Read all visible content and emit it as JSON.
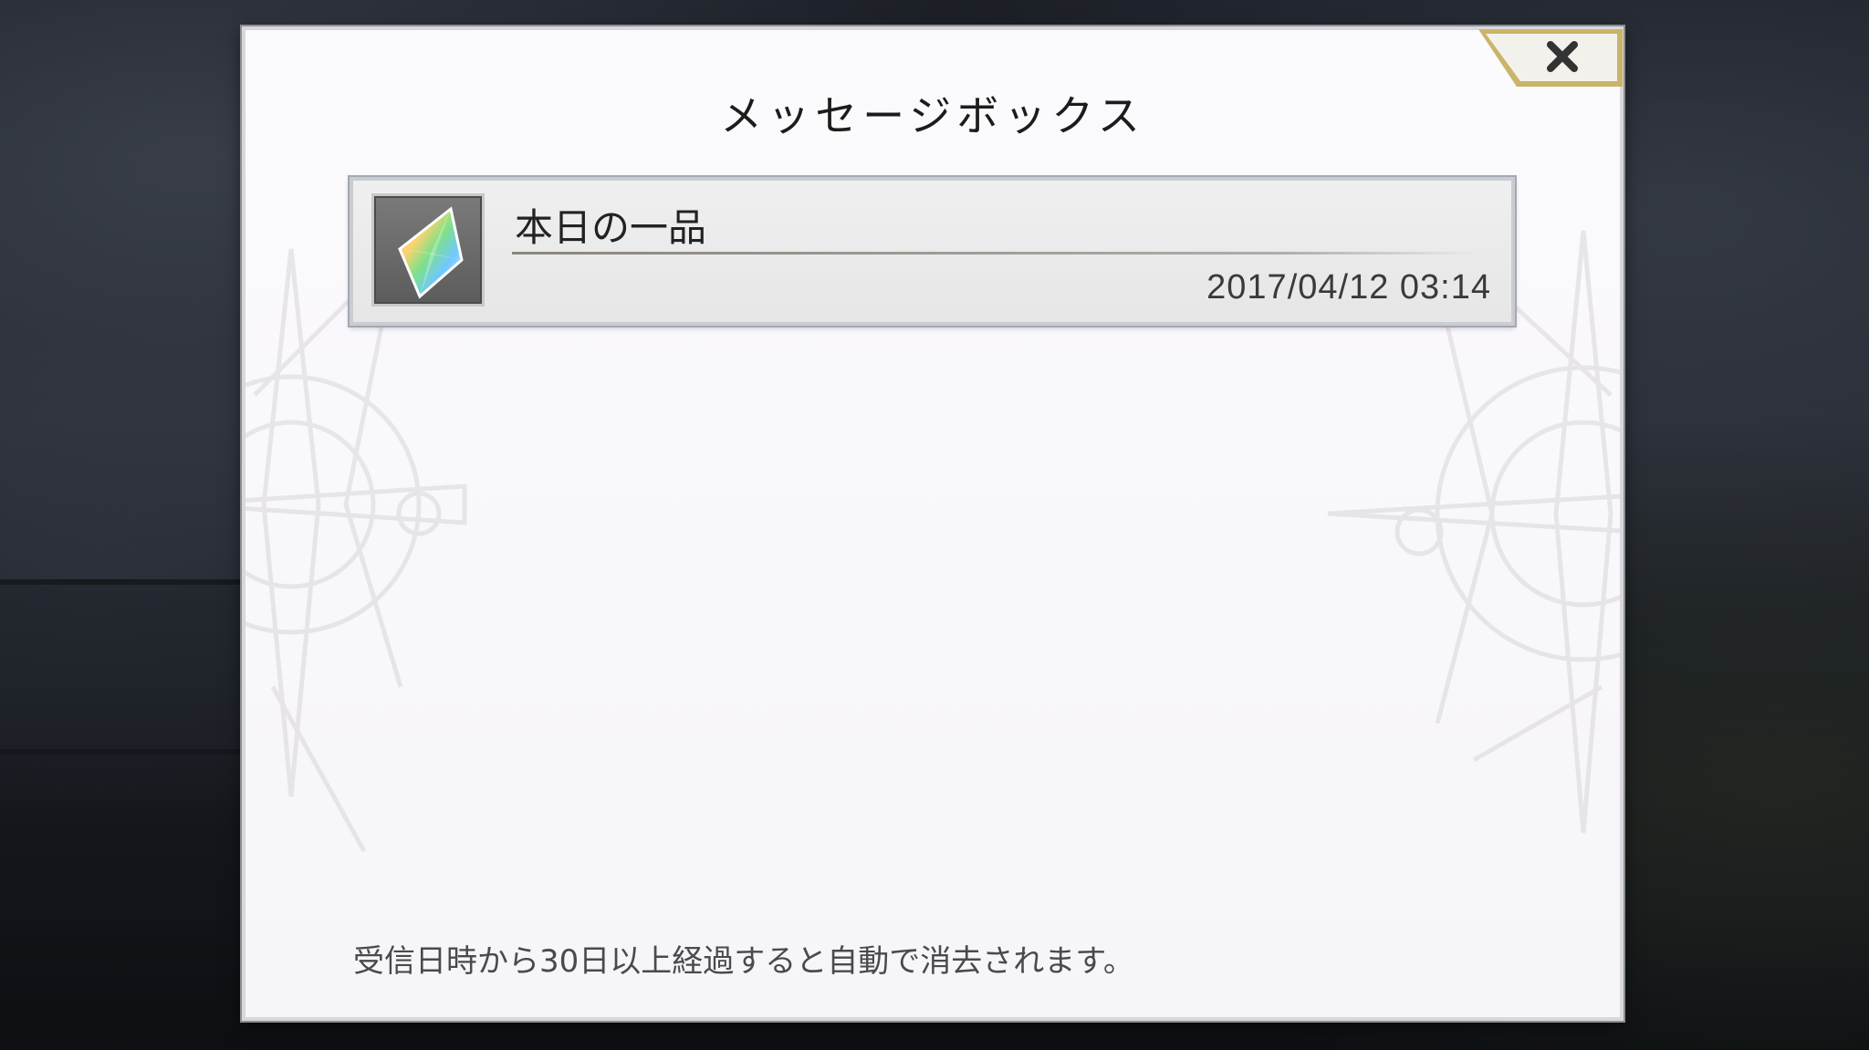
{
  "dialog": {
    "title": "メッセージボックス",
    "close_icon": "close-icon"
  },
  "messages": [
    {
      "title": "本日の一品",
      "date": "2017/04/12 03:14",
      "icon": "rainbow-crystal-icon"
    }
  ],
  "footer": {
    "note": "受信日時から30日以上経過すると自動で消去されます。"
  },
  "colors": {
    "dialog_bg": "#f6f5f9",
    "close_border": "#d8c27a",
    "row_bg": "#e8e8e8"
  }
}
